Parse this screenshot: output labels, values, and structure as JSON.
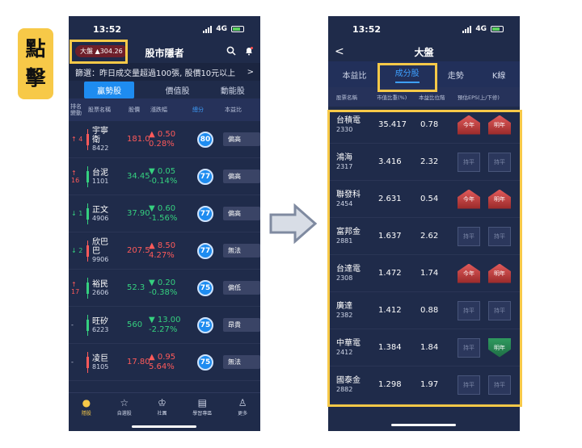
{
  "tap_label": [
    "點",
    "擊"
  ],
  "left": {
    "time": "13:52",
    "network": "4G",
    "index_pill": "大盤 ▲304.26",
    "title": "股市隱者",
    "ticker": "篩選：昨日成交量超過100張, 股價10元以上",
    "ticker_arrow": ">",
    "tabs": [
      "贏勢股",
      "價值股",
      "動能股"
    ],
    "columns": [
      "排名\n變動",
      "股票名稱",
      "股價",
      "漲跌幅",
      "總分",
      "本益比"
    ],
    "rows": [
      {
        "rank": "↑ 4",
        "dir": "up",
        "name": "宇寧\n衛",
        "code": "8422",
        "price": "181.0",
        "chg1": "▲ 0.50",
        "chg2": "0.28%",
        "trend": "red",
        "score": "80",
        "tag": "偏高"
      },
      {
        "rank": "↑ 16",
        "dir": "up",
        "name": "台泥",
        "code": "1101",
        "price": "34.45",
        "chg1": "▼ 0.05",
        "chg2": "-0.14%",
        "trend": "green",
        "score": "77",
        "tag": "偏高"
      },
      {
        "rank": "↓ 1",
        "dir": "down",
        "name": "正文",
        "code": "4906",
        "price": "37.90",
        "chg1": "▼ 0.60",
        "chg2": "-1.56%",
        "trend": "green",
        "score": "77",
        "tag": "偏高"
      },
      {
        "rank": "↓ 2",
        "dir": "down",
        "name": "欣巴\n巴",
        "code": "9906",
        "price": "207.5",
        "chg1": "▲ 8.50",
        "chg2": "4.27%",
        "trend": "red",
        "score": "77",
        "tag": "無法"
      },
      {
        "rank": "↑ 17",
        "dir": "up",
        "name": "裕民",
        "code": "2606",
        "price": "52.3",
        "chg1": "▼ 0.20",
        "chg2": "-0.38%",
        "trend": "green",
        "score": "75",
        "tag": "偏低"
      },
      {
        "rank": "-",
        "dir": "flat",
        "name": "旺矽",
        "code": "6223",
        "price": "560",
        "chg1": "▼ 13.00",
        "chg2": "-2.27%",
        "trend": "green",
        "score": "75",
        "tag": "昂貴"
      },
      {
        "rank": "-",
        "dir": "flat",
        "name": "凌巨",
        "code": "8105",
        "price": "17.80",
        "chg1": "▲ 0.95",
        "chg2": "5.64%",
        "trend": "red",
        "score": "75",
        "tag": "無法"
      }
    ],
    "nav": [
      "隱股",
      "自選股",
      "社團",
      "學習專區",
      "更多"
    ]
  },
  "right": {
    "time": "13:52",
    "network": "4G",
    "back": "<",
    "title": "大盤",
    "tabs": [
      "本益比",
      "成分股",
      "走勢",
      "K線"
    ],
    "columns": [
      "股票名稱",
      "市值比重(%)",
      "本益比位階",
      "預估EPS(上/下修)"
    ],
    "rows": [
      {
        "name": "台積電",
        "code": "2330",
        "weight": "35.417",
        "pe": "0.78",
        "eps1": "今年",
        "eps1_dir": "up",
        "eps2": "明年",
        "eps2_dir": "up"
      },
      {
        "name": "鴻海",
        "code": "2317",
        "weight": "3.416",
        "pe": "2.32",
        "eps1": "持平",
        "eps1_dir": "flat",
        "eps2": "持平",
        "eps2_dir": "flat"
      },
      {
        "name": "聯發科",
        "code": "2454",
        "weight": "2.631",
        "pe": "0.54",
        "eps1": "今年",
        "eps1_dir": "up",
        "eps2": "明年",
        "eps2_dir": "up"
      },
      {
        "name": "富邦金",
        "code": "2881",
        "weight": "1.637",
        "pe": "2.62",
        "eps1": "持平",
        "eps1_dir": "flat",
        "eps2": "持平",
        "eps2_dir": "flat"
      },
      {
        "name": "台達電",
        "code": "2308",
        "weight": "1.472",
        "pe": "1.74",
        "eps1": "今年",
        "eps1_dir": "up",
        "eps2": "明年",
        "eps2_dir": "up"
      },
      {
        "name": "廣達",
        "code": "2382",
        "weight": "1.412",
        "pe": "0.88",
        "eps1": "持平",
        "eps1_dir": "flat",
        "eps2": "持平",
        "eps2_dir": "flat"
      },
      {
        "name": "中華電",
        "code": "2412",
        "weight": "1.384",
        "pe": "1.84",
        "eps1": "持平",
        "eps1_dir": "flat",
        "eps2": "明年",
        "eps2_dir": "down"
      },
      {
        "name": "國泰金",
        "code": "2882",
        "weight": "1.298",
        "pe": "1.97",
        "eps1": "持平",
        "eps1_dir": "flat",
        "eps2": "持平",
        "eps2_dir": "flat"
      }
    ]
  }
}
